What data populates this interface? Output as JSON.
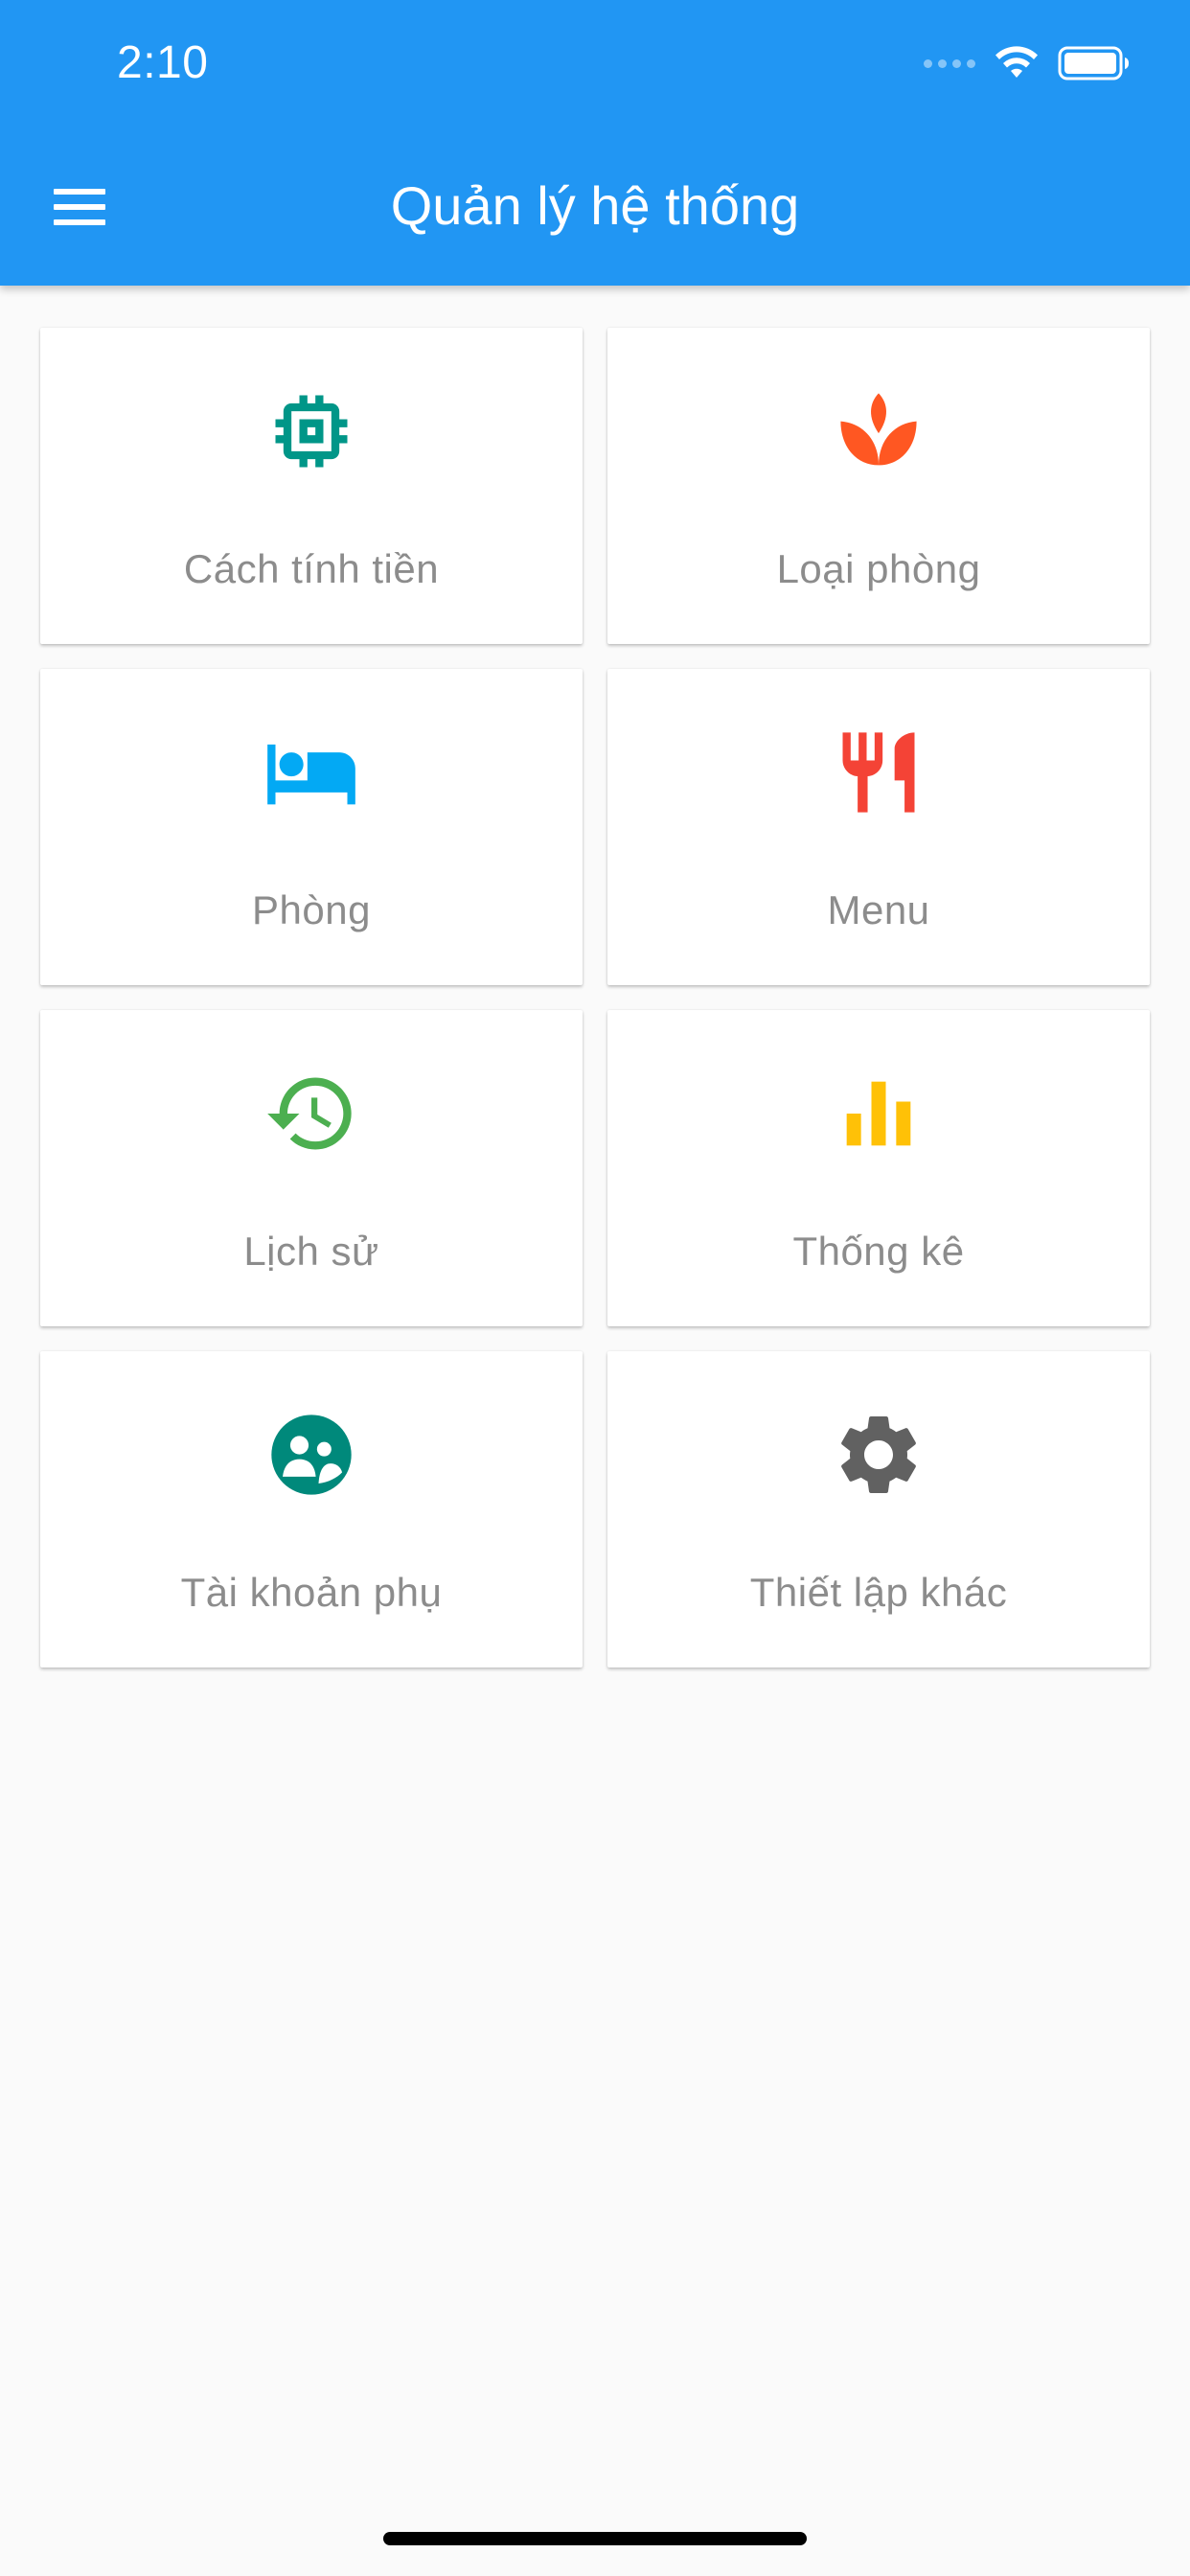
{
  "status_bar": {
    "time": "2:10"
  },
  "app_bar": {
    "title": "Quản lý hệ thống",
    "background_color": "#2196f3"
  },
  "tiles": [
    {
      "label": "Cách tính tiền",
      "icon": "chip-icon",
      "color": "#009688"
    },
    {
      "label": "Loại phòng",
      "icon": "spa-icon",
      "color": "#ff5722"
    },
    {
      "label": "Phòng",
      "icon": "bed-icon",
      "color": "#03a9f4"
    },
    {
      "label": "Menu",
      "icon": "restaurant-icon",
      "color": "#f44336"
    },
    {
      "label": "Lịch sử",
      "icon": "history-icon",
      "color": "#4caf50"
    },
    {
      "label": "Thống kê",
      "icon": "bar-chart-icon",
      "color": "#ffc107"
    },
    {
      "label": "Tài khoản phụ",
      "icon": "supervisor-account-icon",
      "color": "#00897b"
    },
    {
      "label": "Thiết lập khác",
      "icon": "gear-icon",
      "color": "#616161"
    }
  ]
}
